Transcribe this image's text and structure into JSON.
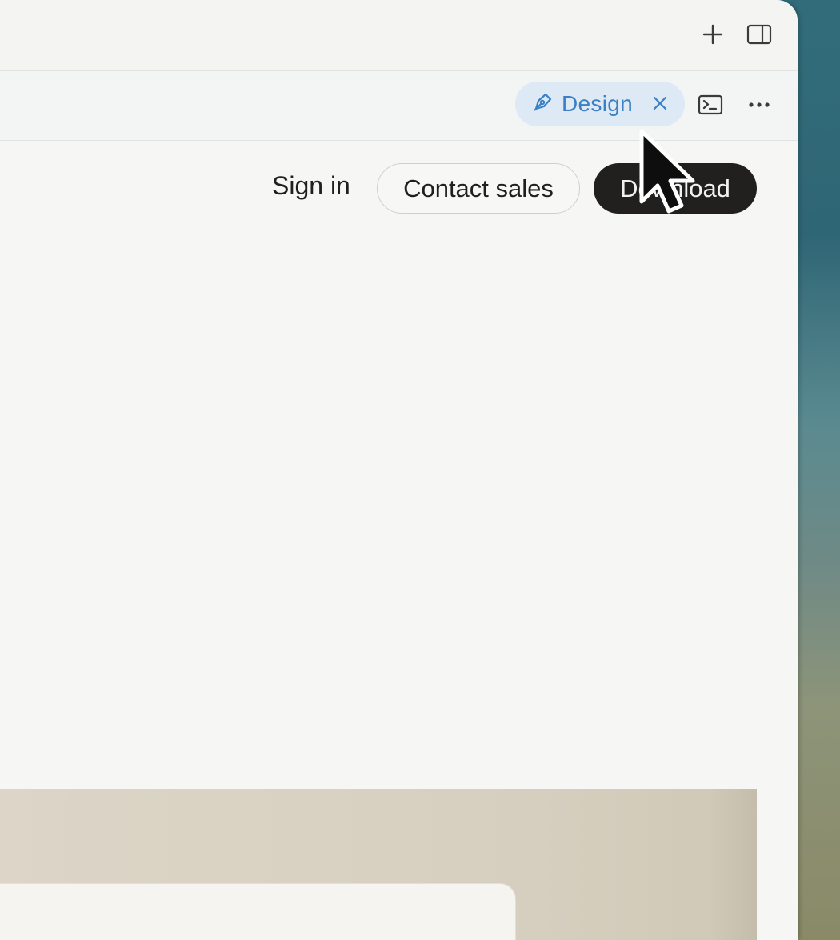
{
  "titlebar": {
    "new_tab_icon": "plus-icon",
    "sidebar_icon": "sidebar-toggle-icon"
  },
  "toolbar": {
    "design_chip": {
      "label": "Design",
      "icon": "pen-nib-icon",
      "close_icon": "close-icon",
      "accent_color": "#3b7fc4"
    },
    "terminal_icon": "terminal-icon",
    "more_icon": "more-horizontal-icon"
  },
  "page_nav": {
    "sign_in": "Sign in",
    "contact_sales": "Contact sales",
    "download": "Download"
  },
  "colors": {
    "window_bg": "#f6f6f5",
    "download_bg": "#22201e",
    "chip_bg": "#dde9f4"
  }
}
